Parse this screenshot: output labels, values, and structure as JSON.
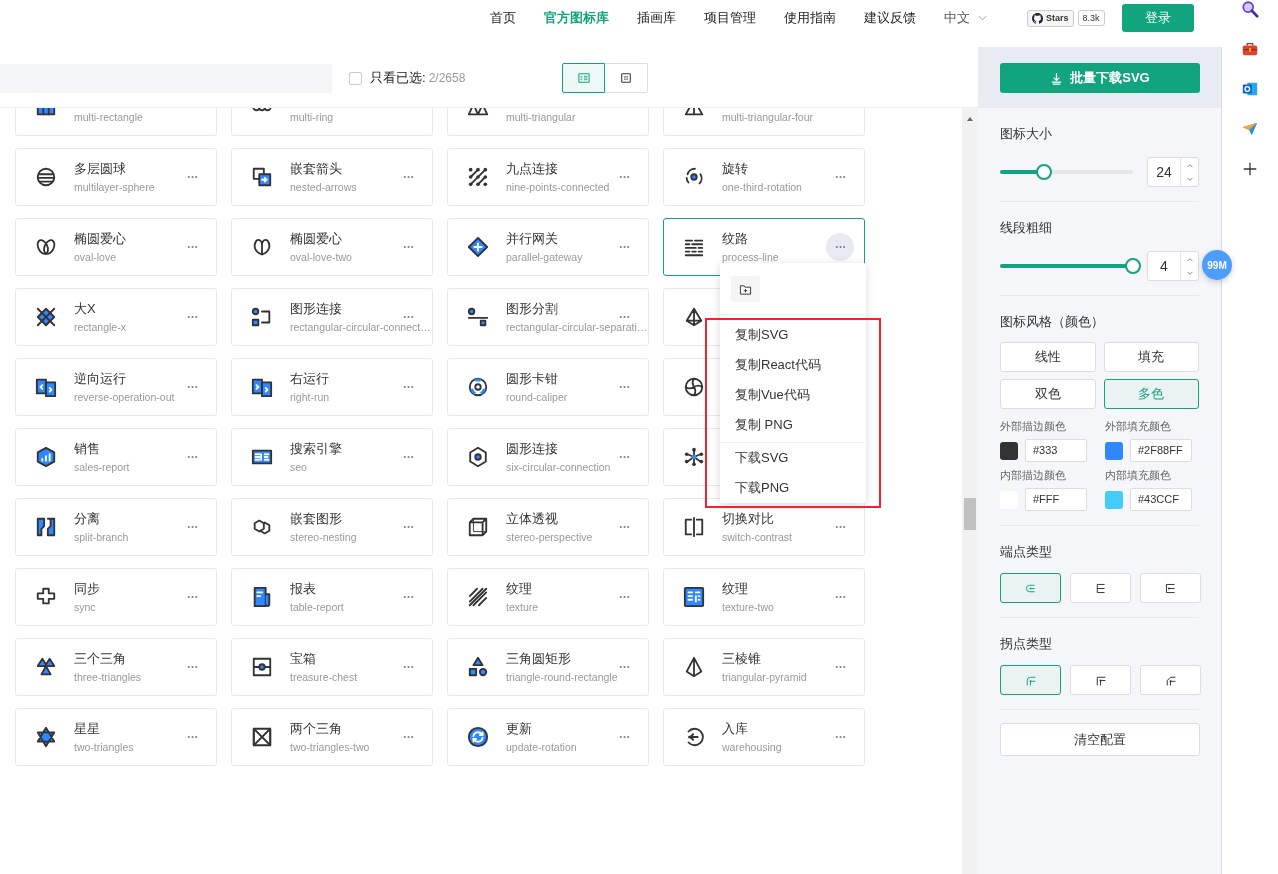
{
  "header": {
    "nav": [
      {
        "label": "首页",
        "selected": false
      },
      {
        "label": "官方图标库",
        "selected": true
      },
      {
        "label": "插画库",
        "selected": false
      },
      {
        "label": "项目管理",
        "selected": false
      },
      {
        "label": "使用指南",
        "selected": false
      },
      {
        "label": "建议反馈",
        "selected": false
      }
    ],
    "language": "中文",
    "github": {
      "label": "Stars",
      "count": "8.3k"
    },
    "login": "登录"
  },
  "toolbar": {
    "only_selected": {
      "label": "只看已选:",
      "checked": false,
      "count": "2/2658"
    },
    "views": [
      {
        "selected": true
      },
      {
        "selected": false
      }
    ]
  },
  "icons": [
    {
      "en": "multi-rectangle",
      "selected": false
    },
    {
      "en": "multi-ring",
      "selected": false
    },
    {
      "en": "multi-triangular",
      "selected": false
    },
    {
      "en": "multi-triangular-four",
      "selected": false
    },
    {
      "name": "多层圆球",
      "en": "multilayer-sphere",
      "selected": false
    },
    {
      "name": "嵌套箭头",
      "en": "nested-arrows",
      "selected": false
    },
    {
      "name": "九点连接",
      "en": "nine-points-connected",
      "selected": false
    },
    {
      "name": "旋转",
      "en": "one-third-rotation",
      "selected": false
    },
    {
      "name": "椭圆爱心",
      "en": "oval-love",
      "selected": false
    },
    {
      "name": "椭圆爱心",
      "en": "oval-love-two",
      "selected": false
    },
    {
      "name": "并行网关",
      "en": "parallel-gateway",
      "selected": false
    },
    {
      "name": "纹路",
      "en": "process-line",
      "selected": true
    },
    {
      "name": "大X",
      "en": "rectangle-x",
      "selected": false
    },
    {
      "name": "图形连接",
      "en": "rectangular-circular-connect…",
      "selected": false
    },
    {
      "name": "图形分割",
      "en": "rectangular-circular-separati…",
      "selected": false
    },
    {
      "selected": false
    },
    {
      "name": "逆向运行",
      "en": "reverse-operation-out",
      "selected": false
    },
    {
      "name": "右运行",
      "en": "right-run",
      "selected": false
    },
    {
      "name": "圆形卡钳",
      "en": "round-caliper",
      "selected": false
    },
    {
      "selected": false
    },
    {
      "name": "销售",
      "en": "sales-report",
      "selected": false
    },
    {
      "name": "搜索引擎",
      "en": "seo",
      "selected": false
    },
    {
      "name": "圆形连接",
      "en": "six-circular-connection",
      "selected": false
    },
    {
      "selected": false
    },
    {
      "name": "分离",
      "en": "split-branch",
      "selected": false
    },
    {
      "name": "嵌套图形",
      "en": "stereo-nesting",
      "selected": false
    },
    {
      "name": "立体透视",
      "en": "stereo-perspective",
      "selected": false
    },
    {
      "name": "切换对比",
      "en": "switch-contrast",
      "selected": false
    },
    {
      "name": "同步",
      "en": "sync",
      "selected": false
    },
    {
      "name": "报表",
      "en": "table-report",
      "selected": false
    },
    {
      "name": "纹理",
      "en": "texture",
      "selected": false
    },
    {
      "name": "纹理",
      "en": "texture-two",
      "selected": false
    },
    {
      "name": "三个三角",
      "en": "three-triangles",
      "selected": false
    },
    {
      "name": "宝箱",
      "en": "treasure-chest",
      "selected": false
    },
    {
      "name": "三角圆矩形",
      "en": "triangle-round-rectangle",
      "selected": false
    },
    {
      "name": "三棱锥",
      "en": "triangular-pyramid",
      "selected": false
    },
    {
      "name": "星星",
      "en": "two-triangles",
      "selected": false
    },
    {
      "name": "两个三角",
      "en": "two-triangles-two",
      "selected": false
    },
    {
      "name": "更新",
      "en": "update-rotation",
      "selected": false
    },
    {
      "name": "入库",
      "en": "warehousing",
      "selected": false
    }
  ],
  "menu": {
    "highlight": true,
    "groups": [
      [
        "复制SVG",
        "复制React代码",
        "复制Vue代码",
        "复制 PNG"
      ],
      [
        "下载SVG",
        "下载PNG"
      ]
    ]
  },
  "panel": {
    "download": "批量下载SVG",
    "size": {
      "label": "图标大小",
      "level": 0.33,
      "value": "24"
    },
    "stroke": {
      "label": "线段粗细",
      "level": 1,
      "value": "4"
    },
    "style": {
      "label": "图标风格（颜色）",
      "options": [
        {
          "label": "线性",
          "selected": false
        },
        {
          "label": "填充",
          "selected": false
        },
        {
          "label": "双色",
          "selected": false
        },
        {
          "label": "多色",
          "selected": true
        }
      ]
    },
    "colors": [
      {
        "label": "外部描边颜色",
        "color": "#333333",
        "value": "#333"
      },
      {
        "label": "外部填充颜色",
        "color": "#2f88ff",
        "value": "#2F88FF"
      },
      {
        "label": "内部描边颜色",
        "color": "#ffffff",
        "value": "#FFF"
      },
      {
        "label": "内部填充颜色",
        "color": "#43ccf8",
        "value": "#43CCF"
      }
    ],
    "caps": {
      "label": "端点类型",
      "options": [
        {
          "selected": true
        },
        {
          "selected": false
        },
        {
          "selected": false
        }
      ]
    },
    "joins": {
      "label": "拐点类型",
      "options": [
        {
          "selected": true
        },
        {
          "selected": false
        },
        {
          "selected": false
        }
      ]
    },
    "reset": "清空配置"
  },
  "badge": "99M"
}
